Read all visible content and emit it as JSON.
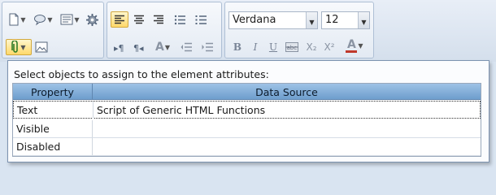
{
  "toolbar": {
    "font_name": "Verdana",
    "font_size": "12",
    "buttons": {
      "bold": "B",
      "italic": "I",
      "underline": "U",
      "subscript": "X₂",
      "superscript": "X²",
      "font_color": "A"
    }
  },
  "panel": {
    "instruction": "Select objects to assign to the element attributes:",
    "columns": [
      "Property",
      "Data Source"
    ],
    "rows": [
      {
        "property": "Text",
        "source": "Script of Generic HTML Functions"
      },
      {
        "property": "Visible",
        "source": ""
      },
      {
        "property": "Disabled",
        "source": ""
      }
    ]
  },
  "colors": {
    "header_top": "#9ec2e6",
    "header_bottom": "#6e9ecd",
    "toolbar_bg": "#d9e4f1",
    "selected_button": "#ffd96b"
  }
}
